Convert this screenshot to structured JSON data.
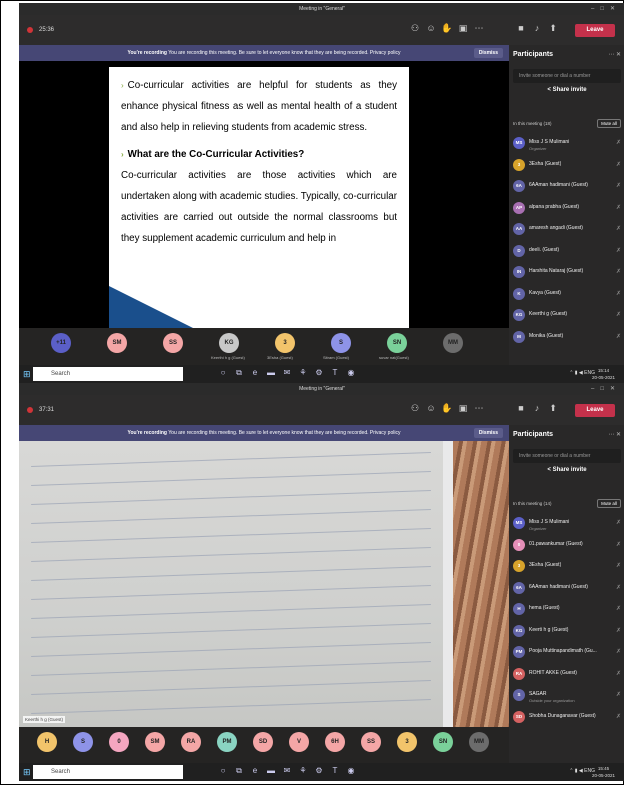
{
  "window_title": "Meeting in \"General\"",
  "recording_banner": {
    "title": "You're recording",
    "text": "You are recording this meeting. Be sure to let everyone know that they are being recorded. Privacy policy",
    "dismiss": "Dismiss"
  },
  "toolbar": {
    "leave": "Leave"
  },
  "panel": {
    "title": "Participants",
    "invite_placeholder": "Invite someone or dial a number",
    "share_invite": "Share invite",
    "mute_all": "Mute all"
  },
  "shot1": {
    "timer": "25:36",
    "slide": {
      "p1": "Co-curricular activities are helpful for students as they enhance physical fitness as well as mental health of a student and also help in relieving students from academic stress.",
      "heading": "What are the Co-Curricular Activities?",
      "p2": "Co-curricular activities are those activities which are undertaken along with academic studies. Typically, co-curricular activities are carried out outside the normal classrooms but they supplement academic curriculum and help in"
    },
    "speaker": "suvar nat(Guest)",
    "in_meeting": "In this meeting (18)",
    "participants": [
      {
        "initials": "MS",
        "name": "Miss J S Mulimani",
        "sub": "Organizer",
        "color": "#5b5fc7"
      },
      {
        "initials": "3",
        "name": "3Esha (Guest)",
        "sub": "",
        "color": "#d7a32b"
      },
      {
        "initials": "6A",
        "name": "6AAman hadimani (Guest)",
        "sub": "",
        "color": "#6264a7"
      },
      {
        "initials": "AP",
        "name": "alpana prabha (Guest)",
        "sub": "",
        "color": "#a86fb2"
      },
      {
        "initials": "AA",
        "name": "amaresh angadi (Guest)",
        "sub": "",
        "color": "#6264a7"
      },
      {
        "initials": "D",
        "name": "deeli. (Guest)",
        "sub": "",
        "color": "#6264a7"
      },
      {
        "initials": "IN",
        "name": "Harshita Nataraj (Guest)",
        "sub": "",
        "color": "#6264a7"
      },
      {
        "initials": "K",
        "name": "Kavya (Guest)",
        "sub": "",
        "color": "#6264a7"
      },
      {
        "initials": "KG",
        "name": "Keerthi g (Guest)",
        "sub": "",
        "color": "#6264a7"
      },
      {
        "initials": "M",
        "name": "Monika (Guest)",
        "sub": "",
        "color": "#6264a7"
      }
    ],
    "tiles": [
      {
        "initials": "+11",
        "label": "",
        "color": "#5b5fc7"
      },
      {
        "initials": "SM",
        "label": "",
        "color": "#f4a6a6"
      },
      {
        "initials": "SS",
        "label": "",
        "color": "#f4a6a6"
      },
      {
        "initials": "KG",
        "label": "Keerthi h g (Guest)",
        "color": "#c8c8c8"
      },
      {
        "initials": "3",
        "label": "3Esha (Guest)",
        "color": "#f2c46b"
      },
      {
        "initials": "S",
        "label": "Sitram (Guest)",
        "color": "#8e93e8"
      },
      {
        "initials": "SN",
        "label": "suvar nat(Guest)",
        "color": "#7ad19a"
      },
      {
        "initials": "MM",
        "label": "",
        "color": "#6c6c6c"
      }
    ],
    "clock_time": "15:14",
    "clock_date": "20-05-2021",
    "lang": "ENG"
  },
  "shot2": {
    "timer": "37:31",
    "speaker": "Keerthi h g (Guest)",
    "in_meeting": "In this meeting (14)",
    "participants": [
      {
        "initials": "MS",
        "name": "Miss J S Mulimani",
        "sub": "Organizer",
        "color": "#5b5fc7"
      },
      {
        "initials": "0",
        "name": "01.pawankumar (Guest)",
        "sub": "",
        "color": "#e58fb8"
      },
      {
        "initials": "3",
        "name": "3Esha (Guest)",
        "sub": "",
        "color": "#d7a32b"
      },
      {
        "initials": "6A",
        "name": "6AAman hadimani (Guest)",
        "sub": "",
        "color": "#6264a7"
      },
      {
        "initials": "H",
        "name": "hema (Guest)",
        "sub": "",
        "color": "#6264a7"
      },
      {
        "initials": "KG",
        "name": "Keerti h g (Guest)",
        "sub": "",
        "color": "#6264a7"
      },
      {
        "initials": "PM",
        "name": "Pooja Muttinapandimath (Gu...",
        "sub": "",
        "color": "#6264a7"
      },
      {
        "initials": "RA",
        "name": "ROHIT AKKE (Guest)",
        "sub": "",
        "color": "#d46161"
      },
      {
        "initials": "S",
        "name": "SAGAR",
        "sub": "Outside your organization",
        "color": "#6264a7"
      },
      {
        "initials": "SD",
        "name": "Shobha Dunaganavar (Guest)",
        "sub": "",
        "color": "#d46161"
      }
    ],
    "tiles": [
      {
        "initials": "H",
        "color": "#f2c46b"
      },
      {
        "initials": "S",
        "color": "#8e93e8"
      },
      {
        "initials": "0",
        "color": "#f4a6c0"
      },
      {
        "initials": "SM",
        "color": "#f4a6a6"
      },
      {
        "initials": "RA",
        "color": "#f4a6a6"
      },
      {
        "initials": "PM",
        "color": "#8ad4c2"
      },
      {
        "initials": "SD",
        "color": "#f4a6a6"
      },
      {
        "initials": "V",
        "color": "#f4a6a6"
      },
      {
        "initials": "6H",
        "color": "#f4a6a6"
      },
      {
        "initials": "SS",
        "color": "#f4a6a6"
      },
      {
        "initials": "3",
        "color": "#f2c46b"
      },
      {
        "initials": "SN",
        "color": "#7ad19a"
      },
      {
        "initials": "MM",
        "color": "#6c6c6c"
      }
    ],
    "clock_time": "15:45",
    "clock_date": "20-05-2021",
    "lang": "ENG"
  },
  "taskbar": {
    "search": "Search"
  }
}
